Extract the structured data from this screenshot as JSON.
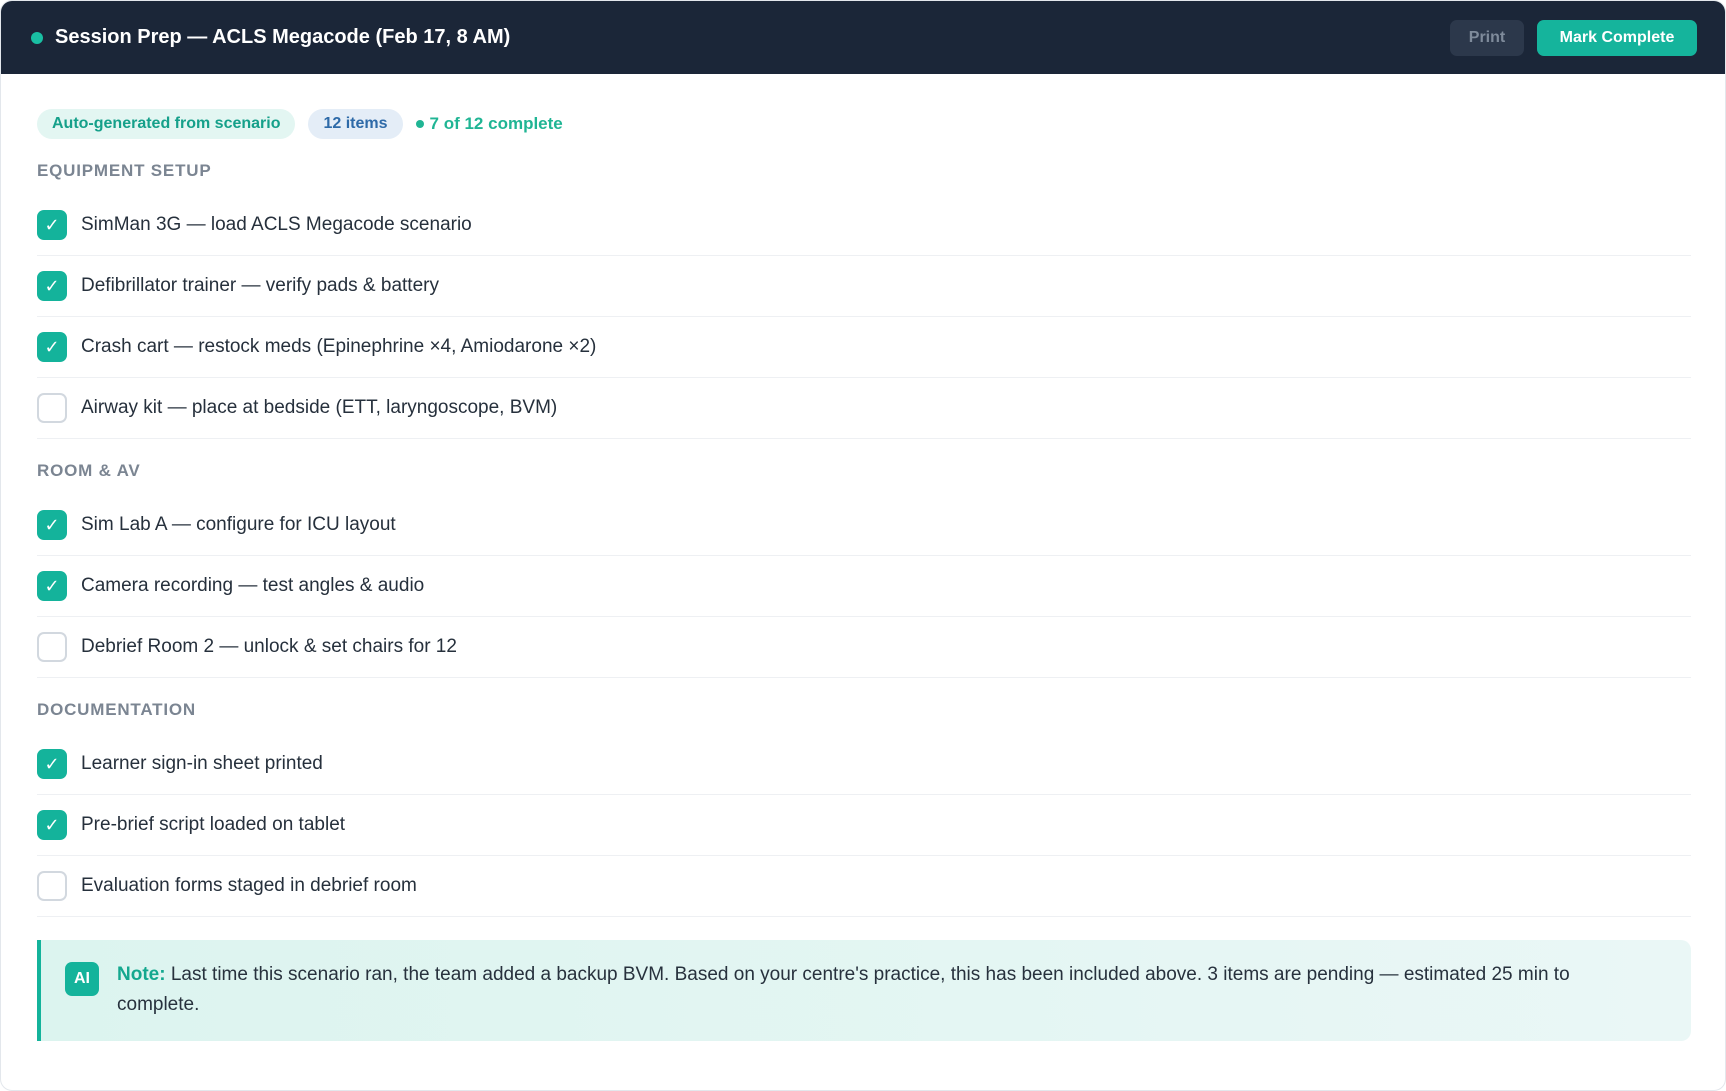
{
  "header": {
    "title": "Session Prep — ACLS Megacode (Feb 17, 8 AM)",
    "print_label": "Print",
    "complete_label": "Mark Complete"
  },
  "meta": {
    "source_chip": "Auto-generated from scenario",
    "count_chip": "12 items",
    "progress": "7 of 12 complete"
  },
  "sections": [
    {
      "title": "EQUIPMENT SETUP",
      "items": [
        {
          "label": "SimMan 3G — load ACLS Megacode scenario",
          "checked": true
        },
        {
          "label": "Defibrillator trainer — verify pads & battery",
          "checked": true
        },
        {
          "label": "Crash cart — restock meds (Epinephrine ×4, Amiodarone ×2)",
          "checked": true
        },
        {
          "label": "Airway kit — place at bedside (ETT, laryngoscope, BVM)",
          "checked": false
        }
      ]
    },
    {
      "title": "ROOM & AV",
      "items": [
        {
          "label": "Sim Lab A — configure for ICU layout",
          "checked": true
        },
        {
          "label": "Camera recording — test angles & audio",
          "checked": true
        },
        {
          "label": "Debrief Room 2 — unlock & set chairs for 12",
          "checked": false
        }
      ]
    },
    {
      "title": "DOCUMENTATION",
      "items": [
        {
          "label": "Learner sign-in sheet printed",
          "checked": true
        },
        {
          "label": "Pre-brief script loaded on tablet",
          "checked": true
        },
        {
          "label": "Evaluation forms staged in debrief room",
          "checked": false
        }
      ]
    }
  ],
  "note": {
    "badge": "AI",
    "label": "Note:",
    "text": "Last time this scenario ran, the team added a backup BVM. Based on your centre's practice, this has been included above. 3 items are pending — estimated 25 min to complete."
  },
  "icons": {
    "check": "checkmark-icon",
    "status": "status-dot-icon"
  },
  "colors": {
    "header_bg": "#1b2638",
    "accent": "#14b39b",
    "progress": "#20b594",
    "chip_auto_bg": "#e3f6f2",
    "chip_count_bg": "#e4edf7"
  }
}
